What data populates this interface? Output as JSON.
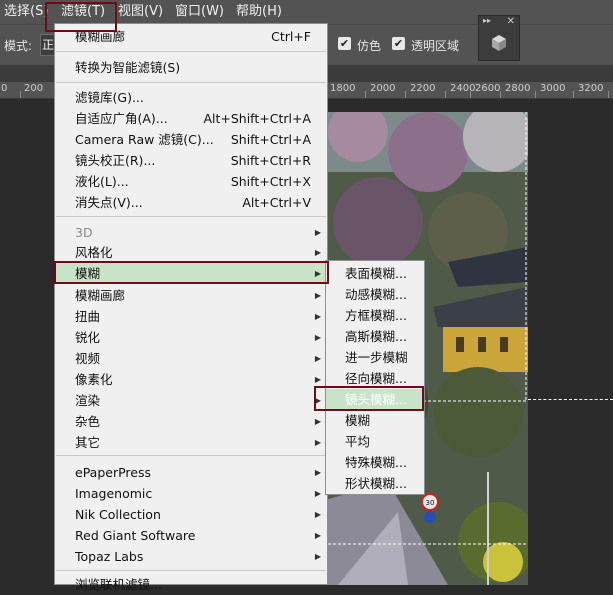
{
  "menubar": {
    "select": "选择(S)",
    "filter": "滤镜(T)",
    "view": "视图(V)",
    "window": "窗口(W)",
    "help": "帮助(H)"
  },
  "toolbar": {
    "mode_label": "模式:",
    "mode_value": "正",
    "dither_label": "仿色",
    "transparency_label": "透明区域"
  },
  "ruler": [
    "0",
    "200",
    "1800",
    "2000",
    "2200",
    "2400",
    "2600",
    "2800",
    "3000",
    "3200"
  ],
  "filter_menu": {
    "items": [
      {
        "label": "模糊画廊",
        "shortcut": "Ctrl+F"
      },
      {
        "label": "转换为智能滤镜(S)"
      },
      {
        "label": "滤镜库(G)..."
      },
      {
        "label": "自适应广角(A)...",
        "shortcut": "Alt+Shift+Ctrl+A"
      },
      {
        "label": "Camera Raw 滤镜(C)...",
        "shortcut": "Shift+Ctrl+A"
      },
      {
        "label": "镜头校正(R)...",
        "shortcut": "Shift+Ctrl+R"
      },
      {
        "label": "液化(L)...",
        "shortcut": "Shift+Ctrl+X"
      },
      {
        "label": "消失点(V)...",
        "shortcut": "Alt+Ctrl+V"
      },
      {
        "label": "3D"
      },
      {
        "label": "风格化"
      },
      {
        "label": "模糊"
      },
      {
        "label": "模糊画廊"
      },
      {
        "label": "扭曲"
      },
      {
        "label": "锐化"
      },
      {
        "label": "视频"
      },
      {
        "label": "像素化"
      },
      {
        "label": "渲染"
      },
      {
        "label": "杂色"
      },
      {
        "label": "其它"
      },
      {
        "label": "ePaperPress"
      },
      {
        "label": "Imagenomic"
      },
      {
        "label": "Nik Collection"
      },
      {
        "label": "Red Giant Software"
      },
      {
        "label": "Topaz Labs"
      },
      {
        "label": "浏览联机滤镜..."
      }
    ]
  },
  "blur_submenu": {
    "items": [
      {
        "label": "表面模糊..."
      },
      {
        "label": "动感模糊..."
      },
      {
        "label": "方框模糊..."
      },
      {
        "label": "高斯模糊..."
      },
      {
        "label": "进一步模糊"
      },
      {
        "label": "径向模糊..."
      },
      {
        "label": "镜头模糊..."
      },
      {
        "label": "模糊"
      },
      {
        "label": "平均"
      },
      {
        "label": "特殊模糊..."
      },
      {
        "label": "形状模糊..."
      }
    ]
  },
  "sign_text": "30",
  "colors": {
    "menu_bg": "#f0f0f0",
    "highlight": "#c9e3c9",
    "annotation": "#6b0d16",
    "chrome": "#535353"
  }
}
